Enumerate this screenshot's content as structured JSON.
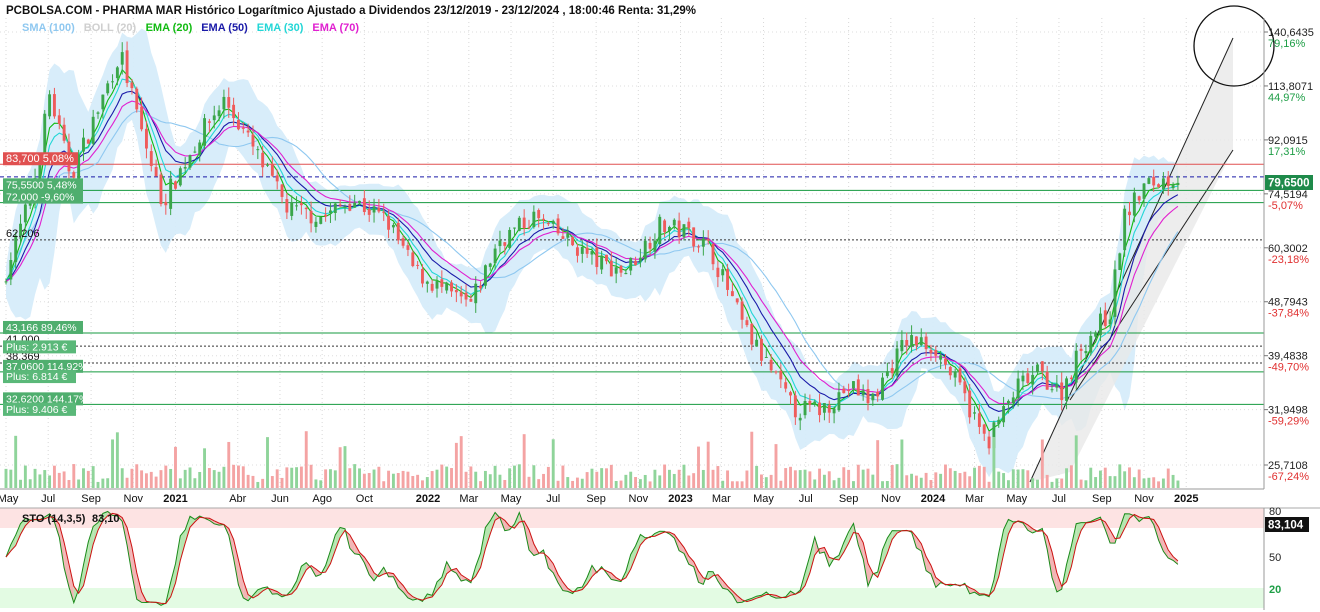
{
  "title": "PCBOLSA.COM - PHARMA MAR Histórico Logarítmico Ajustado a Dividendos 23/12/2019 - 23/12/2024 , 18:00:46 Renta: 31,29%",
  "legend": [
    {
      "label": "SMA (100)",
      "color": "#8fc8f0"
    },
    {
      "label": "BOLL (20)",
      "color": "#cfcfcf"
    },
    {
      "label": "EMA (20)",
      "color": "#11bb11"
    },
    {
      "label": "EMA (50)",
      "color": "#1a1aa8"
    },
    {
      "label": "EMA (30)",
      "color": "#22d6d6"
    },
    {
      "label": "EMA (70)",
      "color": "#e020d0"
    }
  ],
  "colors": {
    "up": "#3aa64a",
    "down": "#ef5b5b",
    "boll_fill": "#d6ecfa",
    "channel_fill": "#e8e8e8",
    "level_green": "#159a3f",
    "level_red": "#e05050"
  },
  "right_axis": [
    {
      "price": "140,6435",
      "pct": "79,16%",
      "pct_color": "#1e9e46"
    },
    {
      "price": "113,8071",
      "pct": "44,97%",
      "pct_color": "#1e9e46"
    },
    {
      "price": "92,0915",
      "pct": "17,31%",
      "pct_color": "#1e9e46"
    },
    {
      "price": "74,5194",
      "pct": "-5,07%",
      "pct_color": "#e03030"
    },
    {
      "price": "60,3002",
      "pct": "-23,18%",
      "pct_color": "#e03030"
    },
    {
      "price": "48,7943",
      "pct": "-37,84%",
      "pct_color": "#e03030"
    },
    {
      "price": "39,4838",
      "pct": "-49,70%",
      "pct_color": "#e03030"
    },
    {
      "price": "31,9498",
      "pct": "-59,29%",
      "pct_color": "#e03030"
    },
    {
      "price": "25,7108",
      "pct": "-67,24%",
      "pct_color": "#e03030"
    }
  ],
  "current_price": "79,6500",
  "x_axis": [
    {
      "label": "May",
      "bold": false
    },
    {
      "label": "Jul",
      "bold": false
    },
    {
      "label": "Sep",
      "bold": false
    },
    {
      "label": "Nov",
      "bold": false
    },
    {
      "label": "2021",
      "bold": true
    },
    {
      "label": "Abr",
      "bold": false
    },
    {
      "label": "Jun",
      "bold": false
    },
    {
      "label": "Ago",
      "bold": false
    },
    {
      "label": "Oct",
      "bold": false
    },
    {
      "label": "2022",
      "bold": true
    },
    {
      "label": "Mar",
      "bold": false
    },
    {
      "label": "May",
      "bold": false
    },
    {
      "label": "Jul",
      "bold": false
    },
    {
      "label": "Sep",
      "bold": false
    },
    {
      "label": "Nov",
      "bold": false
    },
    {
      "label": "2023",
      "bold": true
    },
    {
      "label": "Mar",
      "bold": false
    },
    {
      "label": "May",
      "bold": false
    },
    {
      "label": "Jul",
      "bold": false
    },
    {
      "label": "Sep",
      "bold": false
    },
    {
      "label": "Nov",
      "bold": false
    },
    {
      "label": "2024",
      "bold": true
    },
    {
      "label": "Mar",
      "bold": false
    },
    {
      "label": "May",
      "bold": false
    },
    {
      "label": "Jul",
      "bold": false
    },
    {
      "label": "Sep",
      "bold": false
    },
    {
      "label": "Nov",
      "bold": false
    },
    {
      "label": "2025",
      "bold": true
    }
  ],
  "levels": [
    {
      "price": 83.7,
      "label": "83,700",
      "pct": "5,08%",
      "style": "red-box"
    },
    {
      "price": 75.55,
      "label": "75,5500",
      "pct": "5,48%",
      "style": "green-box"
    },
    {
      "price": 72.0,
      "label": "72,000",
      "pct": "-9,60%",
      "style": "green-box"
    },
    {
      "price": 62.206,
      "label": "62,206",
      "pct": "",
      "style": "plain"
    },
    {
      "price": 43.166,
      "label": "43,166",
      "pct": "89,46%",
      "style": "green-box"
    },
    {
      "price": 41.0,
      "label": "41,000",
      "pct": "",
      "style": "plain"
    },
    {
      "price": 38.369,
      "label": "38,369",
      "pct": "",
      "style": "plain"
    },
    {
      "price": 37.06,
      "label": "37,0600",
      "pct": "114,92%",
      "style": "green-box"
    },
    {
      "price": 32.62,
      "label": "32,6200",
      "pct": "144,17%",
      "style": "green-box"
    }
  ],
  "level_notes": [
    {
      "text": "Plus: 2.913 €",
      "price": 40.0
    },
    {
      "text": "Plus: 6.814 €",
      "price": 35.6
    },
    {
      "text": "Plus: 9.406 €",
      "price": 31.3
    }
  ],
  "sto": {
    "label": "STO (14,3,5)",
    "value": "83,10",
    "box_value": "83,104",
    "levels": [
      "80",
      "50",
      "20"
    ]
  },
  "chart_data": {
    "type": "candlestick",
    "title": "PCBOLSA.COM - PHARMA MAR Histórico Logarítmico Ajustado a Dividendos 23/12/2019 - 23/12/2024 , 18:00:46 Renta: 31,29%",
    "y_scale": "log",
    "ylim": [
      24.0,
      150.0
    ],
    "y_ticks": [
      140.6435,
      113.8071,
      92.0915,
      74.5194,
      60.3002,
      48.7943,
      39.4838,
      31.9498,
      25.7108
    ],
    "x_range": [
      "2020-05",
      "2024-12-23"
    ],
    "price_anchors": [
      [
        "2020-05",
        52
      ],
      [
        "2020-06-15",
        75
      ],
      [
        "2020-07-10",
        110
      ],
      [
        "2020-08-10",
        80
      ],
      [
        "2020-09-20",
        105
      ],
      [
        "2020-10-20",
        130
      ],
      [
        "2020-11-20",
        95
      ],
      [
        "2020-12-20",
        72
      ],
      [
        "2021-02-15",
        95
      ],
      [
        "2021-03-20",
        108
      ],
      [
        "2021-05-10",
        85
      ],
      [
        "2021-06-20",
        70
      ],
      [
        "2021-08-10",
        68
      ],
      [
        "2021-09-20",
        73
      ],
      [
        "2021-11-10",
        67
      ],
      [
        "2021-12-20",
        55
      ],
      [
        "2022-02-10",
        50
      ],
      [
        "2022-03-10",
        48
      ],
      [
        "2022-04-20",
        62
      ],
      [
        "2022-06-10",
        68
      ],
      [
        "2022-07-20",
        63
      ],
      [
        "2022-09-10",
        57
      ],
      [
        "2022-10-20",
        55
      ],
      [
        "2022-12-10",
        66
      ],
      [
        "2023-01-20",
        64
      ],
      [
        "2023-02-20",
        60
      ],
      [
        "2023-04-10",
        44
      ],
      [
        "2023-05-20",
        37
      ],
      [
        "2023-06-20",
        32
      ],
      [
        "2023-07-30",
        32
      ],
      [
        "2023-09-10",
        35
      ],
      [
        "2023-10-10",
        33
      ],
      [
        "2023-11-30",
        42
      ],
      [
        "2024-01-10",
        41
      ],
      [
        "2024-02-20",
        34
      ],
      [
        "2024-03-25",
        28
      ],
      [
        "2024-05-10",
        35
      ],
      [
        "2024-06-10",
        37
      ],
      [
        "2024-07-10",
        34
      ],
      [
        "2024-08-10",
        41
      ],
      [
        "2024-09-20",
        47
      ],
      [
        "2024-10-10",
        68
      ],
      [
        "2024-11-10",
        77
      ],
      [
        "2024-12-23",
        79.65
      ]
    ],
    "series": [
      {
        "name": "SMA (100)",
        "values": []
      },
      {
        "name": "BOLL (20)",
        "values": []
      },
      {
        "name": "EMA (20)",
        "values": []
      },
      {
        "name": "EMA (50)",
        "values": []
      },
      {
        "name": "EMA (30)",
        "values": []
      },
      {
        "name": "EMA (70)",
        "values": []
      }
    ]
  }
}
